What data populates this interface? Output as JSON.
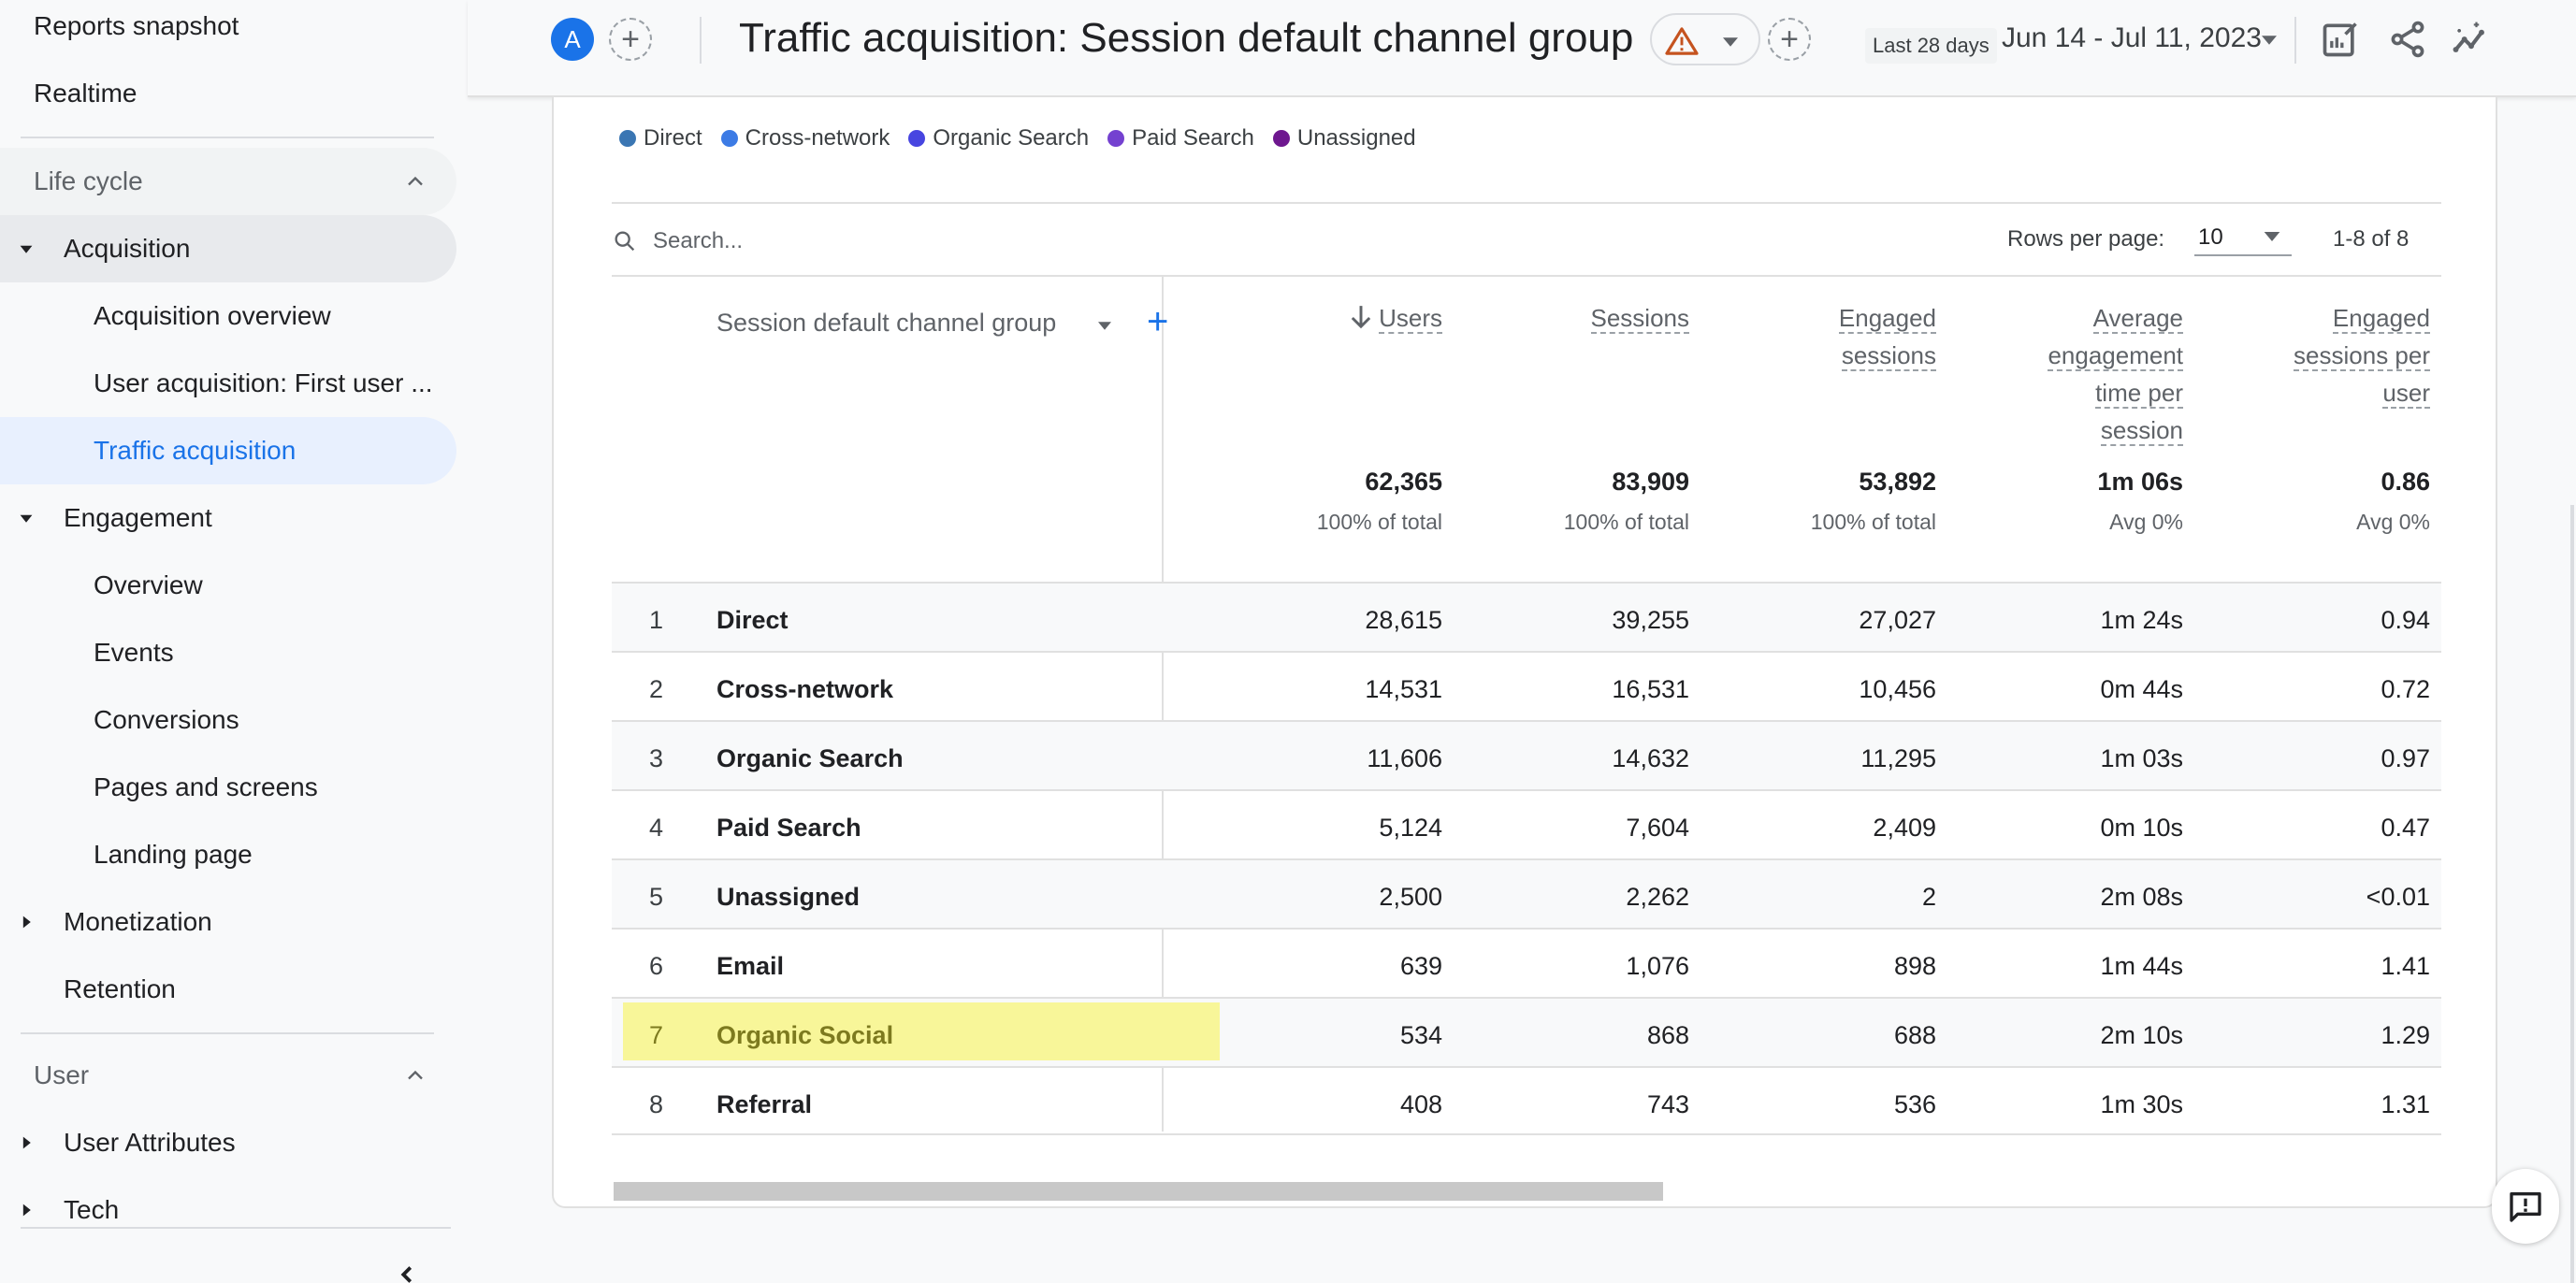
{
  "sidebar": {
    "top_items": [
      "Reports snapshot",
      "Realtime"
    ],
    "sections": [
      {
        "label": "Life cycle",
        "groups": [
          {
            "label": "Acquisition",
            "expanded": true,
            "children": [
              "Acquisition overview",
              "User acquisition: First user ...",
              "Traffic acquisition"
            ],
            "active_child": "Traffic acquisition"
          },
          {
            "label": "Engagement",
            "expanded": true,
            "children": [
              "Overview",
              "Events",
              "Conversions",
              "Pages and screens",
              "Landing page"
            ]
          },
          {
            "label": "Monetization",
            "expanded": false,
            "children": []
          },
          {
            "label": "Retention",
            "expanded": null,
            "children": []
          }
        ]
      },
      {
        "label": "User",
        "groups": [
          {
            "label": "User Attributes",
            "expanded": false,
            "children": []
          },
          {
            "label": "Tech",
            "expanded": false,
            "children": []
          }
        ]
      }
    ]
  },
  "header": {
    "avatar_letter": "A",
    "title": "Traffic acquisition: Session default channel group",
    "date_preset": "Last 28 days",
    "date_range": "Jun 14 - Jul 11, 2023",
    "icons": [
      "customize-report-icon",
      "share-icon",
      "insights-icon"
    ]
  },
  "legend": [
    {
      "label": "Direct",
      "color": "#3a76b3"
    },
    {
      "label": "Cross-network",
      "color": "#3c7be5"
    },
    {
      "label": "Organic Search",
      "color": "#4745e0"
    },
    {
      "label": "Paid Search",
      "color": "#7441d0"
    },
    {
      "label": "Unassigned",
      "color": "#6e178f"
    }
  ],
  "table_controls": {
    "search_placeholder": "Search...",
    "rows_per_page_label": "Rows per page:",
    "rows_per_page_value": "10",
    "pagination": "1-8 of 8"
  },
  "table": {
    "dimension_header": "Session default channel group",
    "metric_headers": [
      {
        "label": "Users",
        "sorted": "desc"
      },
      {
        "label": "Sessions"
      },
      {
        "label": "Engaged sessions"
      },
      {
        "label": "Average engagement time per session"
      },
      {
        "label": "Engaged sessions per user"
      }
    ],
    "metric_header_lines": [
      [
        "Users"
      ],
      [
        "Sessions"
      ],
      [
        "Engaged",
        "sessions"
      ],
      [
        "Average",
        "engagement",
        "time per",
        "session"
      ],
      [
        "Engaged",
        "sessions per",
        "user"
      ]
    ],
    "totals": [
      {
        "value": "62,365",
        "sub": "100% of total"
      },
      {
        "value": "83,909",
        "sub": "100% of total"
      },
      {
        "value": "53,892",
        "sub": "100% of total"
      },
      {
        "value": "1m 06s",
        "sub": "Avg 0%"
      },
      {
        "value": "0.86",
        "sub": "Avg 0%"
      }
    ],
    "rows": [
      {
        "index": "1",
        "channel": "Direct",
        "users": "28,615",
        "sessions": "39,255",
        "engaged_sessions": "27,027",
        "avg_engagement_time": "1m 24s",
        "engaged_per_user": "0.94"
      },
      {
        "index": "2",
        "channel": "Cross-network",
        "users": "14,531",
        "sessions": "16,531",
        "engaged_sessions": "10,456",
        "avg_engagement_time": "0m 44s",
        "engaged_per_user": "0.72"
      },
      {
        "index": "3",
        "channel": "Organic Search",
        "users": "11,606",
        "sessions": "14,632",
        "engaged_sessions": "11,295",
        "avg_engagement_time": "1m 03s",
        "engaged_per_user": "0.97"
      },
      {
        "index": "4",
        "channel": "Paid Search",
        "users": "5,124",
        "sessions": "7,604",
        "engaged_sessions": "2,409",
        "avg_engagement_time": "0m 10s",
        "engaged_per_user": "0.47"
      },
      {
        "index": "5",
        "channel": "Unassigned",
        "users": "2,500",
        "sessions": "2,262",
        "engaged_sessions": "2",
        "avg_engagement_time": "2m 08s",
        "engaged_per_user": "<0.01"
      },
      {
        "index": "6",
        "channel": "Email",
        "users": "639",
        "sessions": "1,076",
        "engaged_sessions": "898",
        "avg_engagement_time": "1m 44s",
        "engaged_per_user": "1.41"
      },
      {
        "index": "7",
        "channel": "Organic Social",
        "users": "534",
        "sessions": "868",
        "engaged_sessions": "688",
        "avg_engagement_time": "2m 10s",
        "engaged_per_user": "1.29",
        "highlighted": true
      },
      {
        "index": "8",
        "channel": "Referral",
        "users": "408",
        "sessions": "743",
        "engaged_sessions": "536",
        "avg_engagement_time": "1m 30s",
        "engaged_per_user": "1.31"
      }
    ]
  },
  "colors": {
    "accent": "#1a73e8",
    "active_nav_bg": "#e8f0fe",
    "highlight": "#f8f699",
    "warning": "#c5531f"
  }
}
